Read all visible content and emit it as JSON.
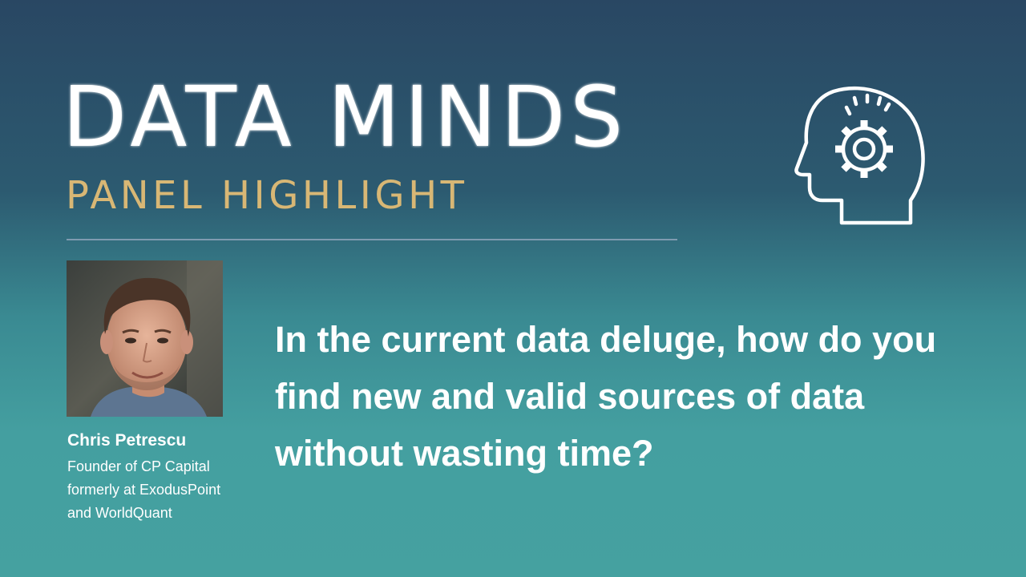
{
  "header": {
    "title": "DATA MINDS",
    "subtitle": "PANEL HIGHLIGHT",
    "icon": "head-with-gear-icon"
  },
  "speaker": {
    "name": "Chris Petrescu",
    "role_lines": [
      "Founder of CP Capital",
      "formerly at ExodusPoint",
      "and WorldQuant"
    ],
    "photo": "speaker-headshot"
  },
  "question": {
    "lines": [
      "In the current data deluge, how do you",
      "find new and valid sources of data",
      "without wasting time?"
    ]
  },
  "colors": {
    "accent_gold": "#d8b775",
    "text": "#ffffff",
    "background_top": "#294763",
    "background_bottom": "#45a1a0"
  }
}
